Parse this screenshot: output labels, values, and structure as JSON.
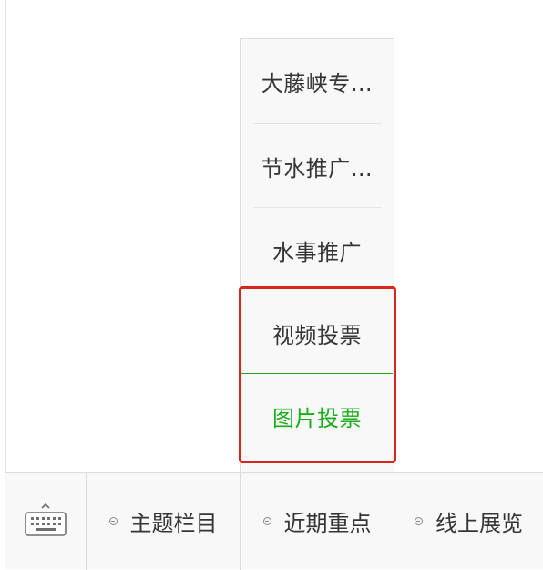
{
  "submenu": {
    "items": [
      {
        "label": "大藤峡专…"
      },
      {
        "label": "节水推广…"
      },
      {
        "label": "水事推广"
      },
      {
        "label": "视频投票"
      },
      {
        "label": "图片投票",
        "active": true
      }
    ]
  },
  "tabbar": {
    "keyboard_icon": "keyboard-icon",
    "tabs": [
      {
        "label": "主题栏目"
      },
      {
        "label": "近期重点"
      },
      {
        "label": "线上展览"
      }
    ]
  },
  "colors": {
    "active_text": "#1aad19",
    "highlight_border": "#d9261c",
    "menu_background": "#f8f8f9",
    "text": "#353535"
  }
}
